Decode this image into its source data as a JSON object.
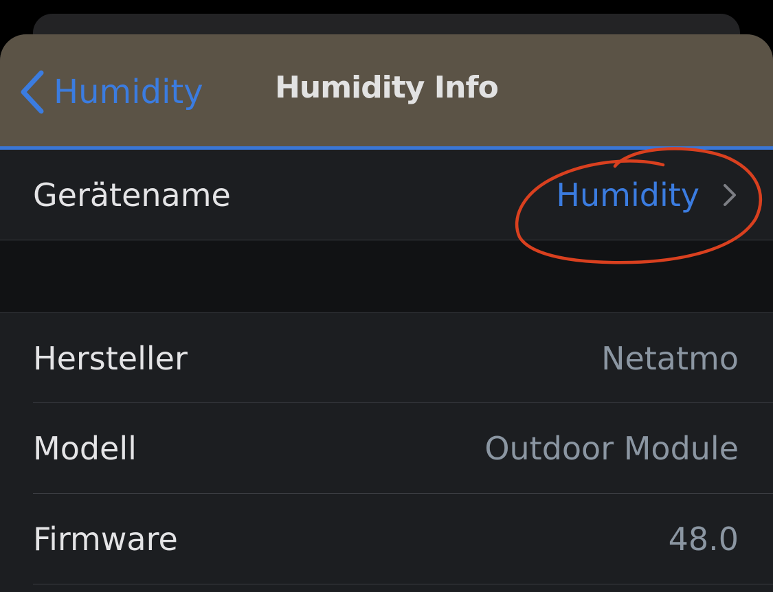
{
  "navigation": {
    "back_label": "Humidity",
    "title": "Humidity Info"
  },
  "name_row": {
    "label": "Gerätename",
    "value": "Humidity"
  },
  "info_rows": [
    {
      "label": "Hersteller",
      "value": "Netatmo"
    },
    {
      "label": "Modell",
      "value": "Outdoor Module"
    },
    {
      "label": "Firmware",
      "value": "48.0"
    }
  ],
  "icons": {
    "back": "chevron-left-icon",
    "disclosure": "chevron-right-icon"
  },
  "colors": {
    "accent": "#3b7ce0",
    "header_background": "#5b5346",
    "annotation_circle": "#d9401f"
  }
}
